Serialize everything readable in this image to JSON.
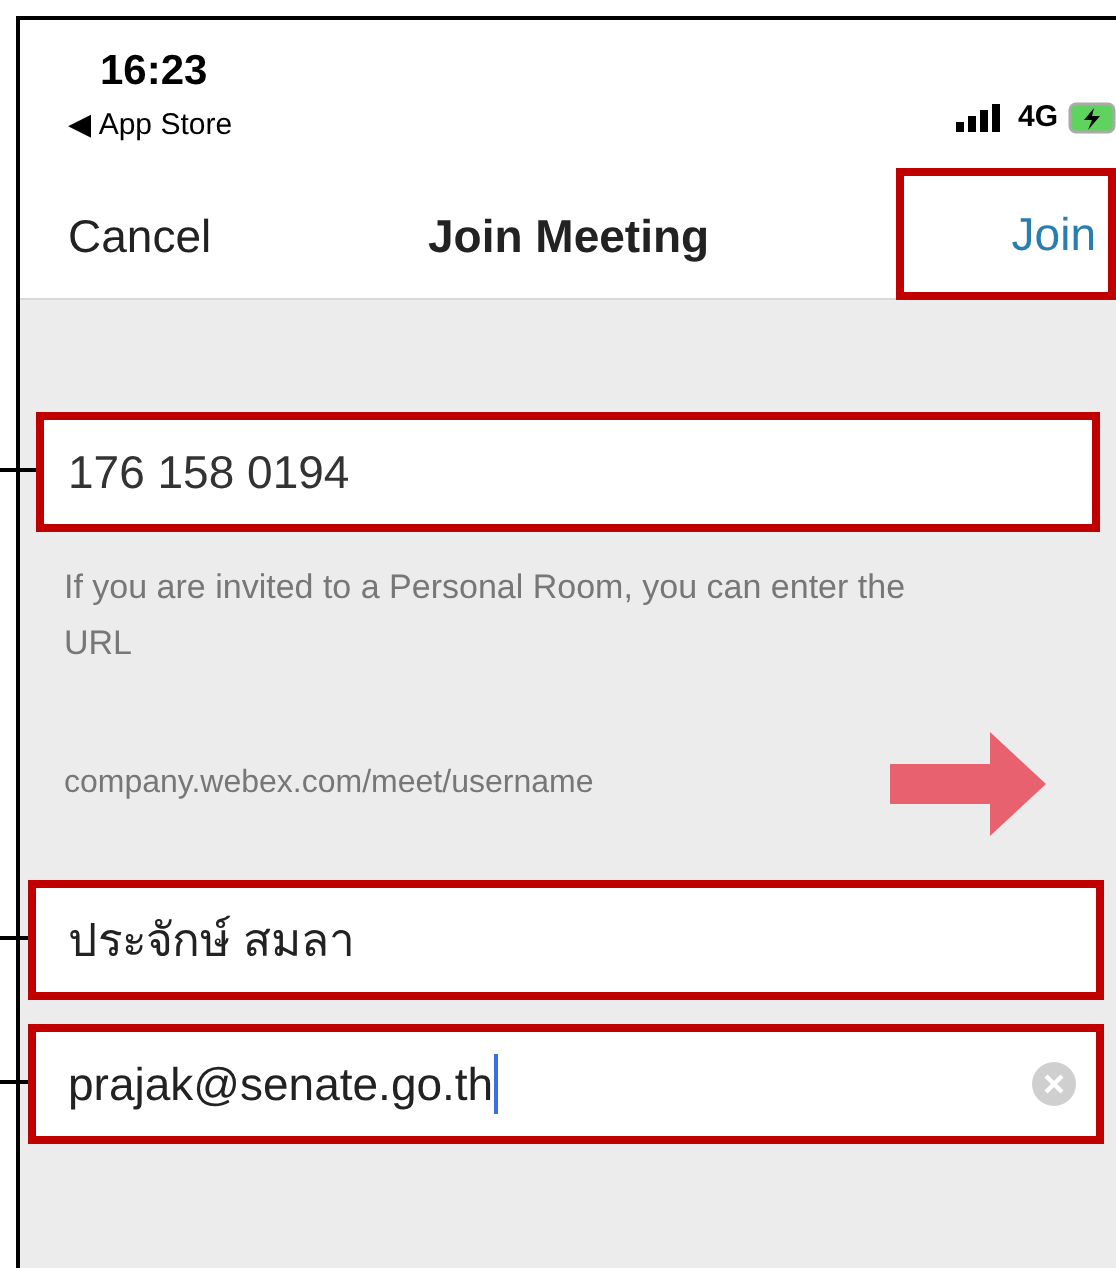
{
  "status_bar": {
    "time": "16:23",
    "back_label": "◀ App Store",
    "network": "4G"
  },
  "nav_bar": {
    "cancel": "Cancel",
    "title": "Join Meeting",
    "join": {
      "label": "Join",
      "highlighted": true
    }
  },
  "meeting_field": {
    "value": "176 158 0194",
    "highlighted": true
  },
  "hint": "If you are invited to a Personal Room, you can enter the URL",
  "url_example": "company.webex.com/meet/username",
  "fields": [
    {
      "value": "ประจักษ์ สมลา",
      "highlighted": true,
      "focused": false,
      "clear_button": false
    },
    {
      "value": "prajak@senate.go.th",
      "highlighted": true,
      "focused": true,
      "clear_button": true
    }
  ]
}
